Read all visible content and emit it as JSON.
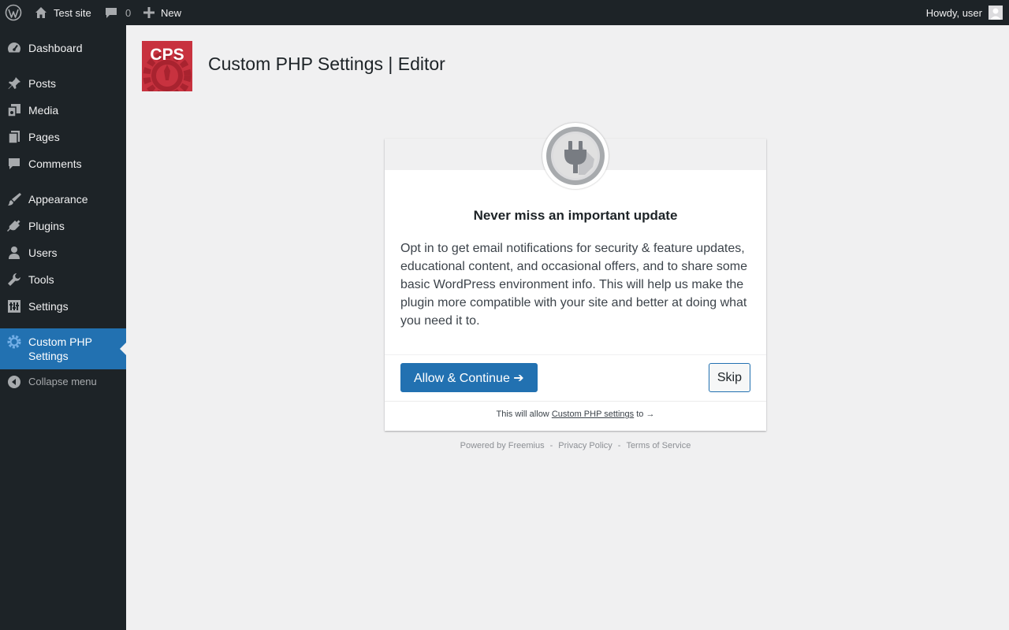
{
  "admin_bar": {
    "site_name": "Test site",
    "comments_count": "0",
    "new_label": "New",
    "howdy": "Howdy, user"
  },
  "sidebar": {
    "items": [
      {
        "label": "Dashboard",
        "icon": "dashboard-icon"
      },
      {
        "label": "Posts",
        "icon": "pin-icon"
      },
      {
        "label": "Media",
        "icon": "media-icon"
      },
      {
        "label": "Pages",
        "icon": "pages-icon"
      },
      {
        "label": "Comments",
        "icon": "comment-icon"
      },
      {
        "label": "Appearance",
        "icon": "brush-icon"
      },
      {
        "label": "Plugins",
        "icon": "plugin-icon"
      },
      {
        "label": "Users",
        "icon": "user-icon"
      },
      {
        "label": "Tools",
        "icon": "wrench-icon"
      },
      {
        "label": "Settings",
        "icon": "settings-icon"
      },
      {
        "label": "Custom PHP Settings",
        "icon": "gear-icon",
        "current": true
      }
    ],
    "collapse_label": "Collapse menu"
  },
  "header": {
    "logo_text": "CPS",
    "title": "Custom PHP Settings | Editor"
  },
  "connect": {
    "heading": "Never miss an important update",
    "description": "Opt in to get email notifications for security & feature updates, educational content, and occasional offers, and to share some basic WordPress environment info. This will help us make the plugin more compatible with your site and better at doing what you need it to.",
    "allow_label": "Allow & Continue ➔",
    "skip_label": "Skip",
    "permissions_prefix": "This will allow",
    "permissions_link": "Custom PHP settings",
    "permissions_suffix": "to →"
  },
  "footer": {
    "powered_by": "Powered by Freemius",
    "privacy": "Privacy Policy",
    "terms": "Terms of Service",
    "separator": "-"
  },
  "colors": {
    "admin_bg": "#1d2327",
    "accent": "#2271b1",
    "page_bg": "#f0f0f1",
    "logo_red": "#c8323f"
  }
}
